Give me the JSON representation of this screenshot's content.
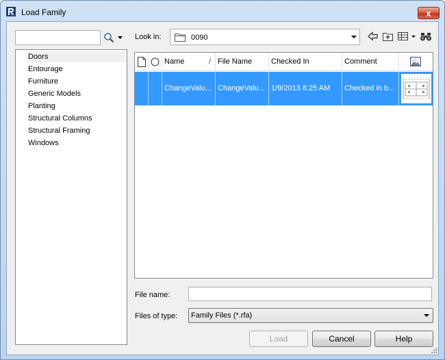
{
  "window": {
    "title": "Load Family",
    "close_label": "x"
  },
  "categories": [
    {
      "label": "Doors",
      "selected": true
    },
    {
      "label": "Entourage"
    },
    {
      "label": "Furniture"
    },
    {
      "label": "Generic Models"
    },
    {
      "label": "Planting"
    },
    {
      "label": "Structural Columns"
    },
    {
      "label": "Structural Framing"
    },
    {
      "label": "Windows"
    }
  ],
  "look_in": {
    "label": "Look in:",
    "value": "0090"
  },
  "grid": {
    "columns": [
      "Name",
      "File Name",
      "Checked In",
      "Comment"
    ],
    "sort_indicator": "/",
    "rows": [
      {
        "name": "ChangeValu...",
        "file_name": "ChangeValu...",
        "checked_in": "1/9/2013 8:25 AM",
        "comment": "Checked in b..."
      }
    ]
  },
  "file_name": {
    "label": "File name:",
    "value": ""
  },
  "files_of_type": {
    "label": "Files of type:",
    "value": "Family Files (*.rfa)"
  },
  "buttons": {
    "load": "Load",
    "cancel": "Cancel",
    "help": "Help"
  },
  "colors": {
    "selection": "#3399ff",
    "frame": "#bcd4ec",
    "close": "#c1361d"
  }
}
